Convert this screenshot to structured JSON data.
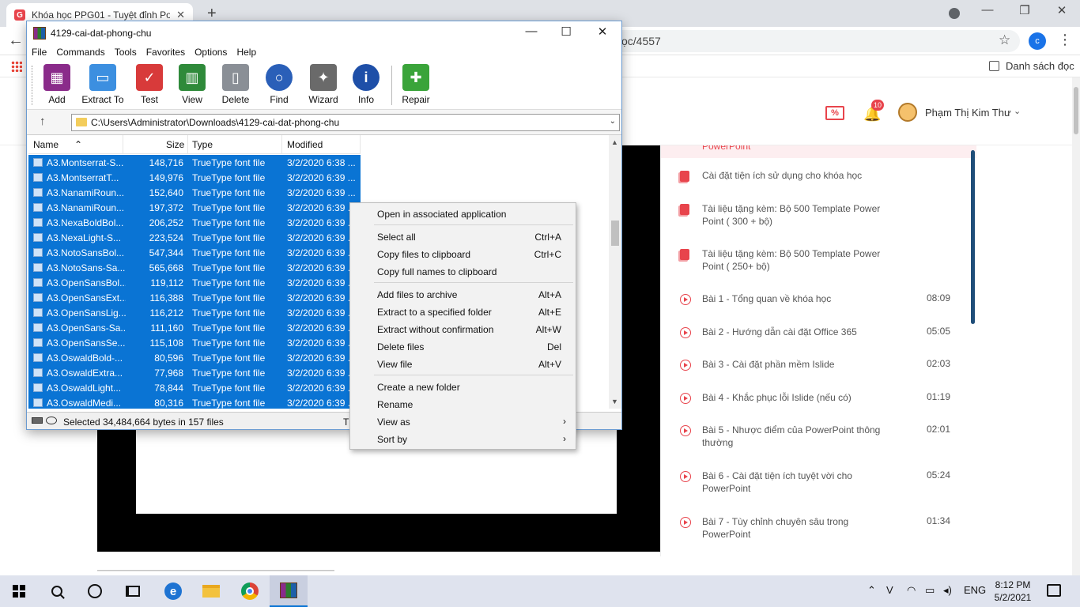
{
  "browser": {
    "tab_title": "Khóa học PPG01 - Tuyệt đỉnh Po...",
    "tab_favicon_letter": "G",
    "tab_close": "✕",
    "new_tab": "+",
    "url_tail": "ọc/4557",
    "profile_letter": "c",
    "reading_list": "Danh sách đọc",
    "win_minimize": "—",
    "win_restore": "❐",
    "win_close": "✕"
  },
  "site": {
    "gift_label": "%",
    "notification_count": "10",
    "user_name": "Phạm Thị Kim Thư",
    "top_partial": "PowerPoint",
    "lessons": [
      {
        "icon": "document-icon",
        "title": "Cài đặt tiện ích sử dụng cho khóa học",
        "time": ""
      },
      {
        "icon": "document-icon",
        "title": "Tài liệu tặng kèm: Bộ 500 Template Power Point ( 300 + bộ)",
        "time": ""
      },
      {
        "icon": "document-icon",
        "title": "Tài liệu tặng kèm: Bộ 500 Template Power Point ( 250+ bộ)",
        "time": ""
      },
      {
        "icon": "play-icon",
        "title": "Bài 1 - Tổng quan về khóa học",
        "time": "08:09"
      },
      {
        "icon": "play-icon",
        "title": "Bài 2 - Hướng dẫn cài đặt Office 365",
        "time": "05:05"
      },
      {
        "icon": "play-icon",
        "title": "Bài 3 - Cài đặt phần mềm Islide",
        "time": "02:03"
      },
      {
        "icon": "play-icon",
        "title": "Bài 4 - Khắc phục lỗi Islide (nếu có)",
        "time": "01:19"
      },
      {
        "icon": "play-icon",
        "title": "Bài 5 - Nhược điểm của PowerPoint thông thường",
        "time": "02:01"
      },
      {
        "icon": "play-icon",
        "title": "Bài 6 - Cài đặt tiện ích tuyệt vời cho PowerPoint",
        "time": "05:24"
      },
      {
        "icon": "play-icon",
        "title": "Bài 7 - Tùy chỉnh chuyên sâu trong PowerPoint",
        "time": "01:34"
      }
    ]
  },
  "winrar": {
    "title": "4129-cai-dat-phong-chu",
    "menu": [
      "File",
      "Commands",
      "Tools",
      "Favorites",
      "Options",
      "Help"
    ],
    "toolbar": [
      {
        "label": "Add",
        "icon": "add-archive-icon",
        "color": "#8a2b8a"
      },
      {
        "label": "Extract To",
        "icon": "extract-folder-icon",
        "color": "#3c8fe0"
      },
      {
        "label": "Test",
        "icon": "test-clipboard-icon",
        "color": "#d83a3a"
      },
      {
        "label": "View",
        "icon": "view-book-icon",
        "color": "#2f8a3a"
      },
      {
        "label": "Delete",
        "icon": "trash-icon",
        "color": "#8a8f96"
      },
      {
        "label": "Find",
        "icon": "magnifier-icon",
        "color": "#2a5fb8"
      },
      {
        "label": "Wizard",
        "icon": "magic-wand-icon",
        "color": "#6a6a6a"
      },
      {
        "label": "Info",
        "icon": "info-icon",
        "color": "#1e4fa8"
      },
      {
        "label": "Repair",
        "icon": "repair-kit-icon",
        "color": "#3aa43a"
      }
    ],
    "address": "C:\\Users\\Administrator\\Downloads\\4129-cai-dat-phong-chu",
    "columns": [
      "Name",
      "Size",
      "Type",
      "Modified"
    ],
    "files": [
      {
        "name": "A3.Montserrat-S...",
        "size": "148,716",
        "type": "TrueType font file",
        "modified": "3/2/2020 6:38 ..."
      },
      {
        "name": "A3.MontserratT...",
        "size": "149,976",
        "type": "TrueType font file",
        "modified": "3/2/2020 6:39 ..."
      },
      {
        "name": "A3.NanamiRoun...",
        "size": "152,640",
        "type": "TrueType font file",
        "modified": "3/2/2020 6:39 ..."
      },
      {
        "name": "A3.NanamiRoun...",
        "size": "197,372",
        "type": "TrueType font file",
        "modified": "3/2/2020 6:39 ..."
      },
      {
        "name": "A3.NexaBoldBol...",
        "size": "206,252",
        "type": "TrueType font file",
        "modified": "3/2/2020 6:39 ..."
      },
      {
        "name": "A3.NexaLight-S...",
        "size": "223,524",
        "type": "TrueType font file",
        "modified": "3/2/2020 6:39 ..."
      },
      {
        "name": "A3.NotoSansBol...",
        "size": "547,344",
        "type": "TrueType font file",
        "modified": "3/2/2020 6:39 ..."
      },
      {
        "name": "A3.NotoSans-Sa...",
        "size": "565,668",
        "type": "TrueType font file",
        "modified": "3/2/2020 6:39 ..."
      },
      {
        "name": "A3.OpenSansBol...",
        "size": "119,112",
        "type": "TrueType font file",
        "modified": "3/2/2020 6:39 ..."
      },
      {
        "name": "A3.OpenSansExt...",
        "size": "116,388",
        "type": "TrueType font file",
        "modified": "3/2/2020 6:39 ..."
      },
      {
        "name": "A3.OpenSansLig...",
        "size": "116,212",
        "type": "TrueType font file",
        "modified": "3/2/2020 6:39 ..."
      },
      {
        "name": "A3.OpenSans-Sa...",
        "size": "111,160",
        "type": "TrueType font file",
        "modified": "3/2/2020 6:39 ..."
      },
      {
        "name": "A3.OpenSansSe...",
        "size": "115,108",
        "type": "TrueType font file",
        "modified": "3/2/2020 6:39 ..."
      },
      {
        "name": "A3.OswaldBold-...",
        "size": "80,596",
        "type": "TrueType font file",
        "modified": "3/2/2020 6:39 ..."
      },
      {
        "name": "A3.OswaldExtra...",
        "size": "77,968",
        "type": "TrueType font file",
        "modified": "3/2/2020 6:39 ..."
      },
      {
        "name": "A3.OswaldLight...",
        "size": "78,844",
        "type": "TrueType font file",
        "modified": "3/2/2020 6:39 ..."
      },
      {
        "name": "A3.OswaldMedi...",
        "size": "80,316",
        "type": "TrueType font file",
        "modified": "3/2/2020 6:39 ..."
      }
    ],
    "status": "Selected 34,484,664 bytes in 157 files",
    "status_right": "T"
  },
  "context_menu": {
    "items": [
      {
        "label": "Open in associated application",
        "shortcut": ""
      },
      {
        "label": "Select all",
        "shortcut": "Ctrl+A"
      },
      {
        "label": "Copy files to clipboard",
        "shortcut": "Ctrl+C"
      },
      {
        "label": "Copy full names to clipboard",
        "shortcut": ""
      },
      {
        "label": "Add files to archive",
        "shortcut": "Alt+A"
      },
      {
        "label": "Extract to a specified folder",
        "shortcut": "Alt+E"
      },
      {
        "label": "Extract without confirmation",
        "shortcut": "Alt+W"
      },
      {
        "label": "Delete files",
        "shortcut": "Del"
      },
      {
        "label": "View file",
        "shortcut": "Alt+V"
      },
      {
        "label": "Create a new folder",
        "shortcut": ""
      },
      {
        "label": "Rename",
        "shortcut": ""
      },
      {
        "label": "View as",
        "shortcut": "",
        "submenu": "›"
      },
      {
        "label": "Sort by",
        "shortcut": "",
        "submenu": "›"
      }
    ]
  },
  "taskbar": {
    "language": "ENG",
    "time": "8:12 PM",
    "date": "5/2/2021",
    "edge_letter": "e"
  },
  "colors": {
    "selection": "#0a74d4",
    "brand_red": "#e8444c",
    "brand_navy": "#1f4e79"
  }
}
